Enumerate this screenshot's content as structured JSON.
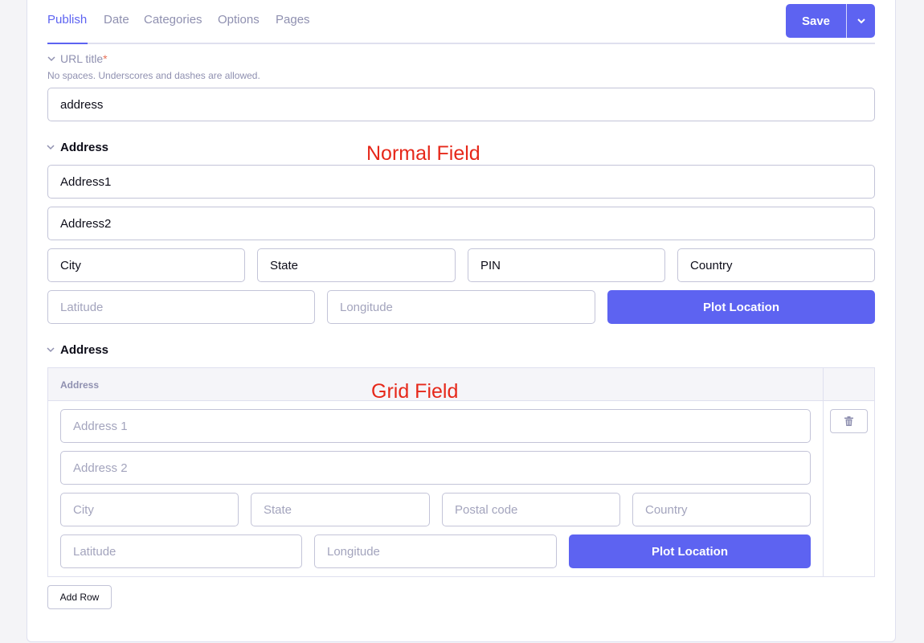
{
  "tabs": [
    {
      "label": "Publish",
      "active": true
    },
    {
      "label": "Date"
    },
    {
      "label": "Categories"
    },
    {
      "label": "Options"
    },
    {
      "label": "Pages"
    }
  ],
  "toolbar": {
    "save_label": "Save",
    "save_dropdown_icon": "chevron-down-icon"
  },
  "url_title": {
    "label": "URL title",
    "required_marker": "*",
    "hint": "No spaces. Underscores and dashes are allowed.",
    "value": "address"
  },
  "normal_field": {
    "label": "Address",
    "annotation": "Normal Field",
    "address1": "Address1",
    "address2": "Address2",
    "city": "City",
    "state": "State",
    "pin": "PIN",
    "country": "Country",
    "latitude_placeholder": "Latitude",
    "longitude_placeholder": "Longitude",
    "plot_button": "Plot Location"
  },
  "grid_field": {
    "label": "Address",
    "annotation": "Grid Field",
    "column_header": "Address",
    "row": {
      "address1_placeholder": "Address 1",
      "address2_placeholder": "Address 2",
      "city_placeholder": "City",
      "state_placeholder": "State",
      "postal_placeholder": "Postal code",
      "country_placeholder": "Country",
      "latitude_placeholder": "Latitude",
      "longitude_placeholder": "Longitude",
      "plot_button": "Plot Location"
    },
    "remove_icon": "trash-icon",
    "add_row_label": "Add Row"
  },
  "colors": {
    "accent": "#5d63f1",
    "annotation": "#e6281a",
    "required": "#e8735a"
  }
}
